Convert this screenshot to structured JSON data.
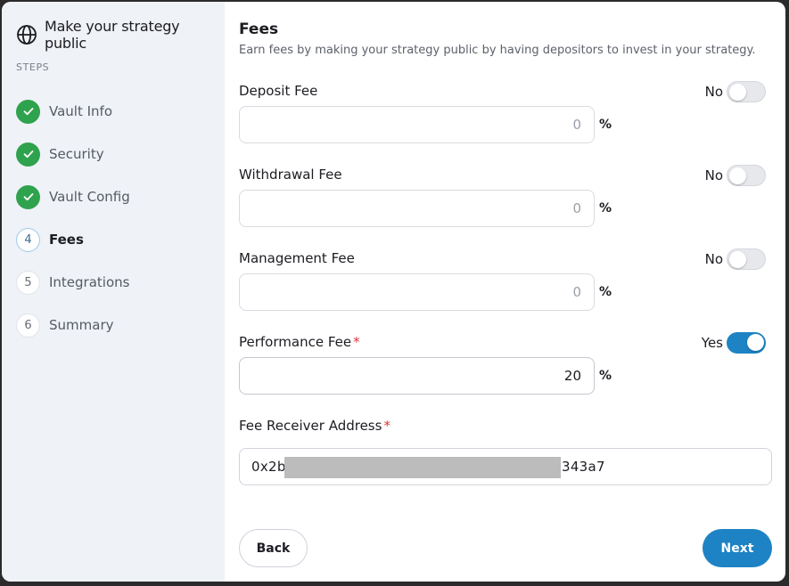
{
  "sidebar": {
    "title": "Make your strategy public",
    "steps_label": "STEPS",
    "steps": [
      {
        "label": "Vault Info",
        "status": "done",
        "number": "1"
      },
      {
        "label": "Security",
        "status": "done",
        "number": "2"
      },
      {
        "label": "Vault Config",
        "status": "done",
        "number": "3"
      },
      {
        "label": "Fees",
        "status": "current",
        "number": "4"
      },
      {
        "label": "Integrations",
        "status": "pending",
        "number": "5"
      },
      {
        "label": "Summary",
        "status": "pending",
        "number": "6"
      }
    ]
  },
  "main": {
    "title": "Fees",
    "subtitle": "Earn fees by making your strategy public by having depositors to invest in your strategy.",
    "fields": [
      {
        "label": "Deposit Fee",
        "required": false,
        "toggle_label": "No",
        "toggle_on": false,
        "value": "0",
        "unit": "%"
      },
      {
        "label": "Withdrawal Fee",
        "required": false,
        "toggle_label": "No",
        "toggle_on": false,
        "value": "0",
        "unit": "%"
      },
      {
        "label": "Management Fee",
        "required": false,
        "toggle_label": "No",
        "toggle_on": false,
        "value": "0",
        "unit": "%"
      },
      {
        "label": "Performance Fee",
        "required": true,
        "toggle_label": "Yes",
        "toggle_on": true,
        "value": "20",
        "unit": "%"
      }
    ],
    "receiver": {
      "label": "Fee Receiver Address",
      "required_mark": "*",
      "value_start": "0x2b",
      "value_end": "343a7"
    },
    "required_mark": "*",
    "back_label": "Back",
    "next_label": "Next"
  },
  "colors": {
    "accent": "#1d83c4",
    "done": "#2fa24d",
    "required": "#e2353a",
    "sidebar_bg": "#eff2f7"
  },
  "icons": {
    "header": "globe-icon",
    "done_step": "check-icon"
  }
}
